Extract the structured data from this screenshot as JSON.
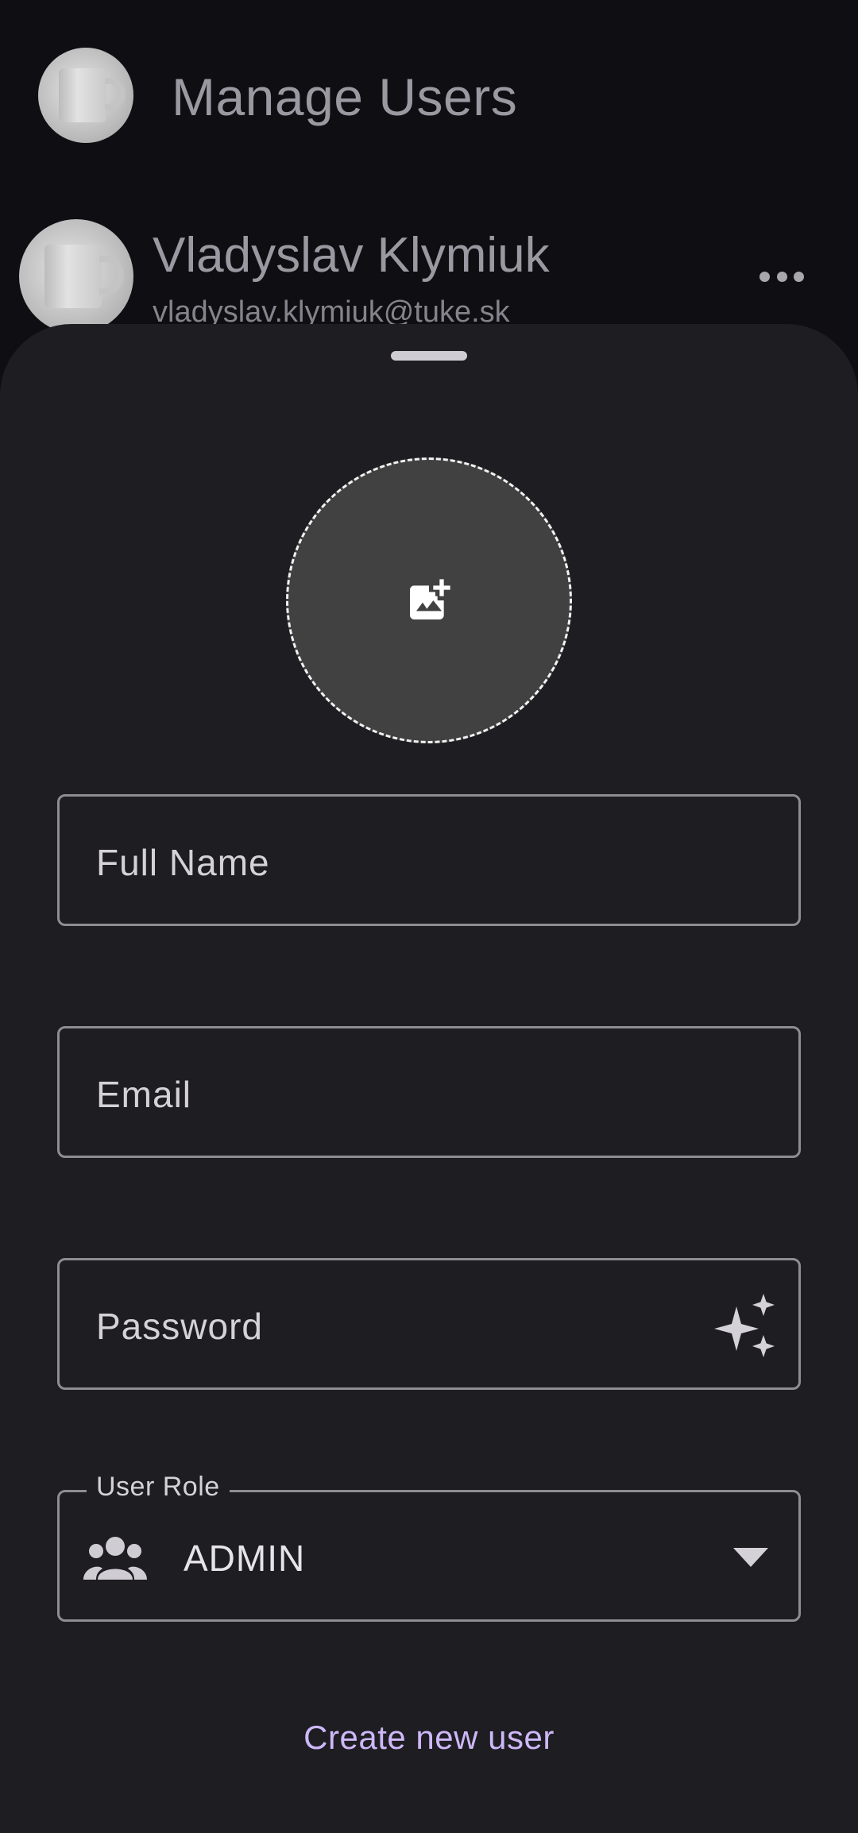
{
  "header": {
    "title": "Manage Users",
    "avatar_icon": "mug-image"
  },
  "user_list": [
    {
      "name": "Vladyslav Klymiuk",
      "email": "vladyslav.klymiuk@tuke.sk"
    }
  ],
  "sheet": {
    "photo_icon": "add-photo-icon",
    "fields": {
      "full_name": {
        "placeholder": "Full Name"
      },
      "email": {
        "placeholder": "Email"
      },
      "password": {
        "placeholder": "Password",
        "action_icon": "sparkle-icon"
      }
    },
    "role": {
      "label": "User Role",
      "value": "ADMIN",
      "icon": "group-icon"
    },
    "submit_label": "Create new user"
  },
  "colors": {
    "background": "#0f0e12",
    "sheet": "#1e1d22",
    "accent": "#cdb8f7",
    "outline": "#8f8d94"
  }
}
